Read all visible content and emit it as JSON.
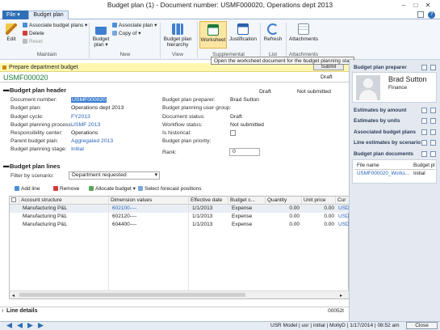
{
  "window": {
    "title": "Budget plan (1) - Document number: USMF000020, Operations dept 2013"
  },
  "tabs": {
    "file": "File",
    "budget_plan": "Budget plan"
  },
  "ribbon": {
    "edit": "Edit",
    "associate_budget_plans": "Associate budget plans",
    "delete": "Delete",
    "reset": "Reset",
    "maintain_group": "Maintain",
    "budget_plan_btn": "Budget plan",
    "associate_plan": "Associate plan",
    "copy_of": "Copy of",
    "new_group": "New",
    "hierarchy": "Budget plan hierarchy",
    "view_group": "View",
    "worksheet": "Worksheet",
    "justification": "Justification",
    "supplemental_group": "Supplemental",
    "refresh": "Refresh",
    "list_group": "List",
    "attachments": "Attachments",
    "attachments_group": "Attachments"
  },
  "tooltip": "Open the worksheet document for the budget planning stage.",
  "prep_bar": {
    "label": "Prepare department budget",
    "submit": "Submit"
  },
  "doc": {
    "number": "USMF000020",
    "status": "Draft"
  },
  "header": {
    "section_title": "Budget plan header",
    "draft": "Draft",
    "not_submitted": "Not submitted",
    "doc_number_label": "Document number:",
    "doc_number": "USMF000020",
    "budget_plan_label": "Budget plan:",
    "budget_plan": "Operations dept 2013",
    "budget_cycle_label": "Budget cycle:",
    "budget_cycle": "FY2013",
    "process_label": "Budget planning process:",
    "process": "USMF 2013",
    "resp_center_label": "Responsibility center:",
    "resp_center": "Operations",
    "parent_label": "Parent budget plan:",
    "parent": "Aggregated 2013",
    "stage_label": "Budget planning stage:",
    "stage": "Initial",
    "preparer_label": "Budget plan preparer:",
    "preparer": "Brad Sutton",
    "user_group_label": "Budget planning user group:",
    "doc_status_label": "Document status:",
    "doc_status": "Draft",
    "workflow_label": "Workflow status:",
    "workflow": "Not submitted",
    "historical_label": "Is historical:",
    "priority_label": "Budget plan priority:",
    "rank_label": "Rank:",
    "rank": "0"
  },
  "lines": {
    "section_title": "Budget plan lines",
    "filter_label": "Filter by scenario:",
    "filter_value": "Department requested",
    "add_line": "Add line",
    "remove": "Remove",
    "allocate": "Allocate budget",
    "select_forecast": "Select forecast positions",
    "columns": [
      "Account structure",
      "Dimension values",
      "Effective date",
      "Budget c...",
      "Quantity",
      "Unit price",
      "Cur"
    ],
    "rows": [
      {
        "account": "Manufacturing P&L",
        "dim": "602100----",
        "date": "1/1/2013",
        "cls": "Expense",
        "qty": "0.00",
        "price": "0.00",
        "cur": "USD"
      },
      {
        "account": "Manufacturing P&L",
        "dim": "602120----",
        "date": "1/1/2013",
        "cls": "Expense",
        "qty": "0.00",
        "price": "0.00",
        "cur": "USD"
      },
      {
        "account": "Manufacturing P&L",
        "dim": "604400----",
        "date": "1/1/2013",
        "cls": "Expense",
        "qty": "0.00",
        "price": "0.00",
        "cur": "USD"
      }
    ]
  },
  "line_details": {
    "label": "Line details",
    "code": "00052t"
  },
  "right_panel": {
    "preparer_hdr": "Budget plan preparer",
    "preparer_name": "Brad Sutton",
    "preparer_dept": "Finance",
    "estimates_amount": "Estimates by amount",
    "estimates_units": "Estimates by units",
    "associated": "Associated budget plans",
    "line_estimates": "Line estimates by scenario",
    "documents": "Budget plan documents",
    "doc_col1": "File name",
    "doc_col2": "Budget pl",
    "doc_file": "USMF000020_Works...",
    "doc_stage": "Initial"
  },
  "status_bar": {
    "model": "USR Model",
    "user": "usr",
    "stage": "initial",
    "account": "MollyD",
    "date": "1/17/2014",
    "time": "08:52 am",
    "close": "Close"
  },
  "colors": {
    "accent": "#2e6fb7",
    "link": "#2a63b8",
    "doc_green": "#1e7a3c",
    "yellow_bar": "#fff7b0"
  }
}
